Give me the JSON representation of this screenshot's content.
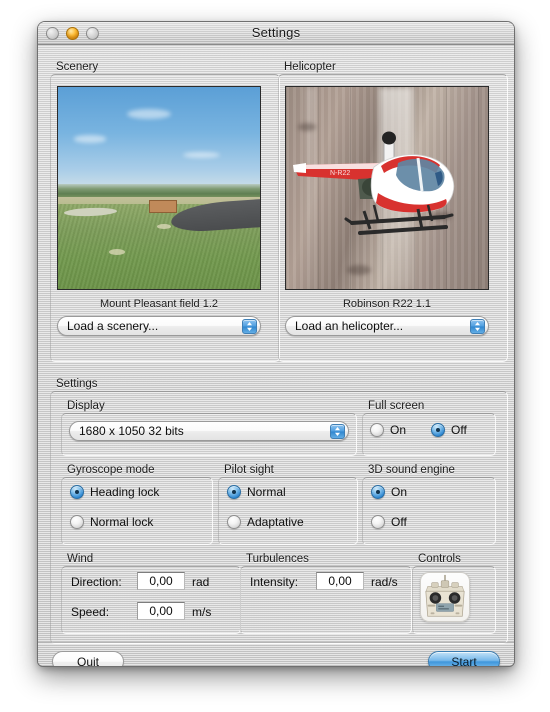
{
  "window": {
    "title": "Settings",
    "traffic_lights": [
      "close",
      "minimize",
      "zoom"
    ]
  },
  "scenery": {
    "group_label": "Scenery",
    "caption": "Mount Pleasant field 1.2",
    "popup_label": "Load a scenery...",
    "image_alt": "grass flying field with blue sky and asphalt runway"
  },
  "helicopter": {
    "group_label": "Helicopter",
    "caption": "Robinson R22 1.1",
    "popup_label": "Load an helicopter...",
    "image_alt": "red and white Robinson R22 helicopter in front of a weathered wall"
  },
  "settings": {
    "group_label": "Settings",
    "display": {
      "label": "Display",
      "value": "1680 x 1050 32 bits"
    },
    "full_screen": {
      "label": "Full screen",
      "options": [
        {
          "label": "On",
          "selected": false
        },
        {
          "label": "Off",
          "selected": true
        }
      ]
    },
    "gyroscope_mode": {
      "label": "Gyroscope mode",
      "options": [
        {
          "label": "Heading lock",
          "selected": true
        },
        {
          "label": "Normal lock",
          "selected": false
        }
      ]
    },
    "pilot_sight": {
      "label": "Pilot sight",
      "options": [
        {
          "label": "Normal",
          "selected": true
        },
        {
          "label": "Adaptative",
          "selected": false
        }
      ]
    },
    "sound_engine": {
      "label": "3D sound engine",
      "options": [
        {
          "label": "On",
          "selected": true
        },
        {
          "label": "Off",
          "selected": false
        }
      ]
    },
    "wind": {
      "label": "Wind",
      "direction": {
        "label": "Direction:",
        "value": "0,00",
        "unit": "rad"
      },
      "speed": {
        "label": "Speed:",
        "value": "0,00",
        "unit": "m/s"
      }
    },
    "turbulences": {
      "label": "Turbulences",
      "intensity": {
        "label": "Intensity:",
        "value": "0,00",
        "unit": "rad/s"
      }
    },
    "controls": {
      "label": "Controls",
      "icon_alt": "rc-transmitter"
    }
  },
  "footer": {
    "quit_label": "Quit",
    "start_label": "Start"
  },
  "colors": {
    "accent_blue": "#3f96dc",
    "selected_radio": "#2f88d2",
    "window_gray": "#cfcfcf",
    "minimize_amber": "#ffbe34"
  }
}
